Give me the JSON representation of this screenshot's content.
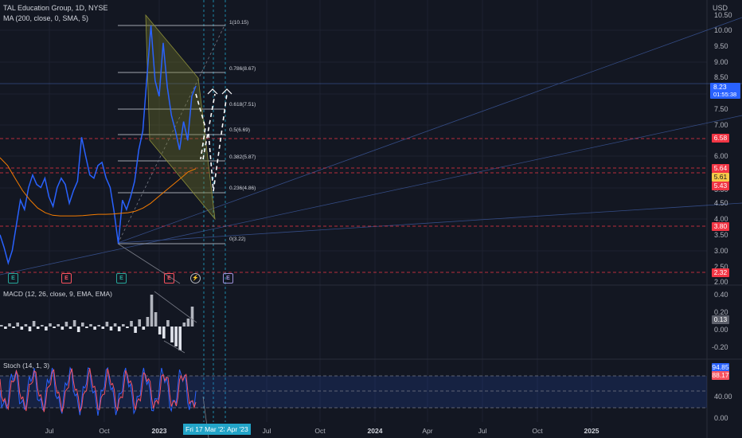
{
  "header": {
    "symbol_line": "TAL Education Group, 1D, NYSE",
    "ma_line": "MA (200, close, 0, SMA, 5)",
    "currency": "USD"
  },
  "price_axis": {
    "ticks": [
      "10.50",
      "10.00",
      "9.50",
      "9.00",
      "8.50",
      "7.50",
      "7.00",
      "6.00",
      "5.50",
      "4.50",
      "4.00",
      "3.50",
      "3.00",
      "2.50",
      "2.00"
    ],
    "last_price": "8.23",
    "countdown": "01:55:38",
    "tags": [
      {
        "text": "6.58",
        "color": "#f23645"
      },
      {
        "text": "5.64",
        "color": "#f23645"
      },
      {
        "text": "5.61",
        "color": "#f7c948"
      },
      {
        "text": "5.43",
        "color": "#f23645"
      },
      {
        "text": "3.80",
        "color": "#f23645"
      },
      {
        "text": "2.32",
        "color": "#f23645"
      }
    ]
  },
  "fib_levels": [
    {
      "text": "1(10.15)"
    },
    {
      "text": "0.786(8.67)"
    },
    {
      "text": "0.618(7.51)"
    },
    {
      "text": "0.5(6.69)"
    },
    {
      "text": "0.382(5.87)"
    },
    {
      "text": "0.236(4.86)"
    },
    {
      "text": "0(3.22)"
    }
  ],
  "events": [
    {
      "text": "E",
      "color": "#26a69a"
    },
    {
      "text": "E",
      "color": "#f7525f"
    },
    {
      "text": "E",
      "color": "#26a69a"
    },
    {
      "text": "E",
      "color": "#f7525f"
    },
    {
      "text": "⚡",
      "color": "#b2b5be"
    },
    {
      "text": "E",
      "color": "#9c8fd8"
    }
  ],
  "macd": {
    "title": "MACD (12, 26, close, 9, EMA, EMA)",
    "ticks": [
      "0.40",
      "0.20",
      "0.00",
      "-0.20"
    ],
    "value": "0.13"
  },
  "stoch": {
    "title": "Stoch (14, 1, 3)",
    "ticks": [
      "40.00",
      "0.00"
    ],
    "k_value": "94.85",
    "d_value": "88.17",
    "k_color": "#2962ff",
    "d_color": "#f7525f"
  },
  "time_axis": {
    "ticks": [
      {
        "text": "Jul",
        "bold": false
      },
      {
        "text": "Oct",
        "bold": false
      },
      {
        "text": "2023",
        "bold": true
      },
      {
        "text": "Jul",
        "bold": false
      },
      {
        "text": "Oct",
        "bold": false
      },
      {
        "text": "2024",
        "bold": true
      },
      {
        "text": "Apr",
        "bold": false
      },
      {
        "text": "Jul",
        "bold": false
      },
      {
        "text": "Oct",
        "bold": false
      },
      {
        "text": "2025",
        "bold": true
      }
    ],
    "highlight_date": "Fri 17 Mar '23",
    "highlight_month": "Apr '23"
  },
  "chart_data": {
    "type": "line",
    "title": "TAL Education Group, 1D, NYSE",
    "xlabel": "",
    "ylabel": "USD",
    "ylim": [
      2.0,
      10.5
    ],
    "series": [
      {
        "name": "",
        "values": [
          3.5,
          3.1,
          2.6,
          3.0,
          3.8,
          4.6,
          4.3,
          5.0,
          5.4,
          5.1,
          5.0,
          5.3,
          4.7,
          4.4,
          5.0,
          5.3,
          5.1,
          4.5,
          4.9,
          5.2,
          6.6,
          6.0,
          5.4,
          5.3,
          5.7,
          5.8,
          5.3,
          5.0,
          4.2,
          3.22,
          4.6,
          4.3,
          4.7,
          5.2,
          6.2,
          6.8,
          8.5,
          10.15,
          8.4,
          7.9,
          9.6,
          8.2,
          7.3,
          6.8,
          6.2,
          7.1,
          6.5,
          7.9,
          8.23
        ]
      },
      {
        "name": "",
        "values": [
          5.95,
          5.7,
          5.3,
          4.9,
          4.6,
          4.35,
          4.2,
          4.12,
          4.1,
          4.1,
          4.1,
          4.11,
          4.13,
          4.15,
          4.15,
          4.16,
          4.18,
          4.2,
          4.25,
          4.35,
          4.5,
          4.7,
          4.9,
          5.1,
          5.3,
          5.5,
          5.6
        ]
      }
    ]
  }
}
